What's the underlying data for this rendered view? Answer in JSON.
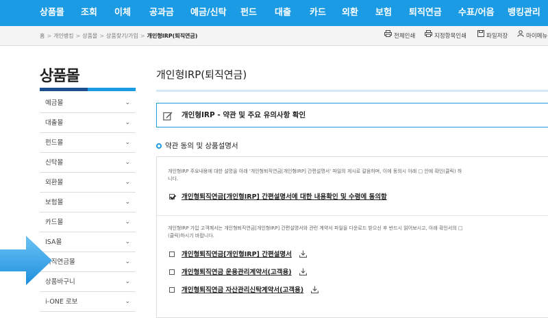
{
  "topnav": {
    "items": [
      "상품몰",
      "조회",
      "이체",
      "공과금",
      "예금/신탁",
      "펀드",
      "대출",
      "카드",
      "외환",
      "보험",
      "퇴직연금",
      "수표/어음",
      "뱅킹관리"
    ]
  },
  "breadcrumb": {
    "items": [
      "홈",
      "개인뱅킹",
      "상품몰",
      "상품찾기/가입"
    ],
    "current": "개인형IRP(퇴직연금)",
    "separator": ">"
  },
  "utils": {
    "print_all": "전체인쇄",
    "print_selected": "지정항목인쇄",
    "save_file": "파일저장",
    "my_menu": "마이메뉴"
  },
  "sidebar": {
    "title": "상품몰",
    "items": [
      {
        "label": "예금몰"
      },
      {
        "label": "대출몰"
      },
      {
        "label": "펀드몰"
      },
      {
        "label": "신탁몰"
      },
      {
        "label": "외환몰"
      },
      {
        "label": "보험몰"
      },
      {
        "label": "카드몰"
      },
      {
        "label": "ISA몰"
      },
      {
        "label": "퇴직연금몰"
      },
      {
        "label": "상품바구니"
      },
      {
        "label": "i-ONE 로보"
      }
    ]
  },
  "main": {
    "title": "개인형IRP(퇴직연금)",
    "notice": "개인형IRP - 약관 및 주요 유의사항 확인",
    "section_title": "약관 동의 및 상품설명서",
    "desc1": "개인형IRP 주요내용에 대한 설명을 아래 '개인형퇴직연금[개인형IRP] 간편설명서' 파일의 게시로 갈음하며, 이에 동의시 아래 □ 안에 확인(클릭) 하",
    "desc1b": "니다.",
    "agree_label": "개인형퇴직연금[개인형IRP] 간편설명서에 대한 내용확인 및 수령에 동의함",
    "desc2": "개인형IRP 가입 고객께서는 개인형퇴직연금[개인형IRP] 간편설명서와 관련 계약서 파일을 다운로드 받으신 후 반드시 읽어보시고, 아래 확인서의 □",
    "desc2b": "(클릭)하시기 바랍니다.",
    "docs": [
      {
        "label": "개인형퇴직연금[개인형IRP] 간편설명서"
      },
      {
        "label": "개인형퇴직연금 운용관리계약서(고객용)"
      },
      {
        "label": "개인형퇴직연금 자산관리신탁계약서(고객용)"
      }
    ]
  },
  "colors": {
    "nav_bg": "#1a9be4",
    "sidebar_bar_dark": "#1a4f91",
    "arrow": "#3aa3e6"
  }
}
